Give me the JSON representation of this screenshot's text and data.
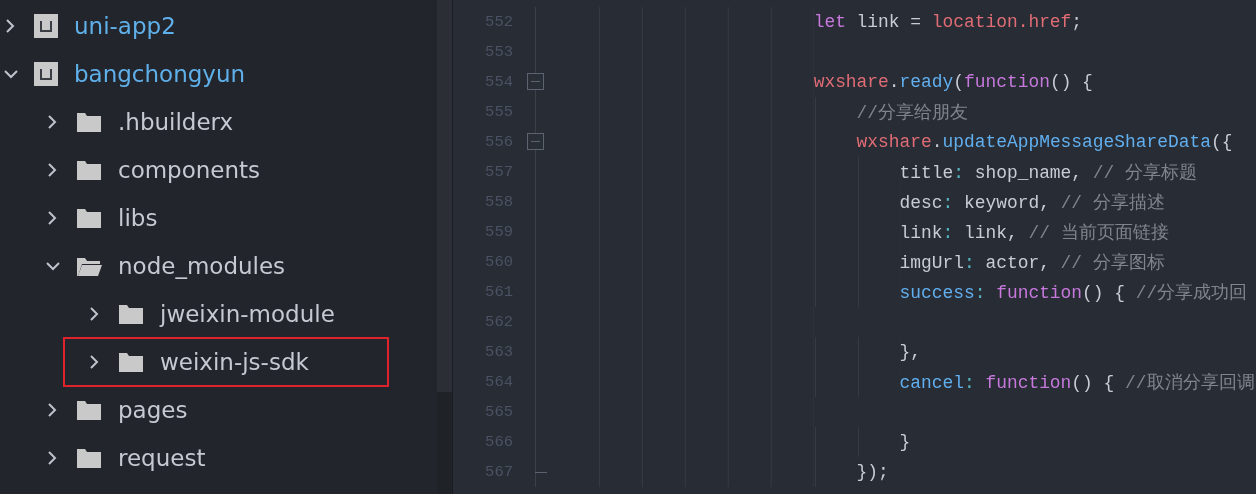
{
  "sidebar": {
    "tree": [
      {
        "kind": "project",
        "name": "uni-app2",
        "expanded": false,
        "highlighted": false
      },
      {
        "kind": "project",
        "name": "bangchongyun",
        "expanded": true,
        "highlighted": false,
        "children": [
          {
            "kind": "folder",
            "name": ".hbuilderx",
            "expanded": false,
            "highlighted": false
          },
          {
            "kind": "folder",
            "name": "components",
            "expanded": false,
            "highlighted": false
          },
          {
            "kind": "folder",
            "name": "libs",
            "expanded": false,
            "highlighted": false
          },
          {
            "kind": "folder",
            "name": "node_modules",
            "expanded": true,
            "highlighted": false,
            "children": [
              {
                "kind": "folder",
                "name": "jweixin-module",
                "expanded": false,
                "highlighted": false
              },
              {
                "kind": "folder",
                "name": "weixin-js-sdk",
                "expanded": false,
                "highlighted": true
              }
            ]
          },
          {
            "kind": "folder",
            "name": "pages",
            "expanded": false,
            "highlighted": false
          },
          {
            "kind": "folder",
            "name": "request",
            "expanded": false,
            "highlighted": false
          }
        ]
      }
    ]
  },
  "editor": {
    "lines": [
      {
        "number": "552",
        "tokens": [
          {
            "kind": "keyword",
            "text": "let"
          },
          {
            "kind": "plain",
            "text": " link = "
          },
          {
            "kind": "object",
            "text": "location.href"
          },
          {
            "kind": "plain",
            "text": ";"
          }
        ]
      },
      {
        "number": "553"
      },
      {
        "number": "554",
        "fold_start": true,
        "tokens": [
          {
            "kind": "object",
            "text": "wxshare"
          },
          {
            "kind": "plain",
            "text": "."
          },
          {
            "kind": "method",
            "text": "ready"
          },
          {
            "kind": "plain",
            "text": "("
          },
          {
            "kind": "keyword",
            "text": "function"
          },
          {
            "kind": "plain",
            "text": "() {"
          }
        ]
      },
      {
        "number": "555",
        "tokens": [
          {
            "kind": "comment",
            "text": "    //分享给朋友"
          }
        ]
      },
      {
        "number": "556",
        "fold_start": true,
        "tokens": [
          {
            "kind": "object",
            "text": "    wxshare"
          },
          {
            "kind": "plain",
            "text": "."
          },
          {
            "kind": "method",
            "text": "updateAppMessageShareData"
          },
          {
            "kind": "plain",
            "text": "({"
          }
        ]
      },
      {
        "number": "557",
        "tokens": [
          {
            "kind": "plain",
            "text": "        title"
          },
          {
            "kind": "colon",
            "text": ":"
          },
          {
            "kind": "plain",
            "text": " shop_name, "
          },
          {
            "kind": "comment",
            "text": "// 分享标题"
          }
        ]
      },
      {
        "number": "558",
        "tokens": [
          {
            "kind": "plain",
            "text": "        desc"
          },
          {
            "kind": "colon",
            "text": ":"
          },
          {
            "kind": "plain",
            "text": " keyword, "
          },
          {
            "kind": "comment",
            "text": "// 分享描述"
          }
        ]
      },
      {
        "number": "559",
        "tokens": [
          {
            "kind": "plain",
            "text": "        link"
          },
          {
            "kind": "colon",
            "text": ":"
          },
          {
            "kind": "plain",
            "text": " link, "
          },
          {
            "kind": "comment",
            "text": "// 当前页面链接"
          }
        ]
      },
      {
        "number": "560",
        "tokens": [
          {
            "kind": "plain",
            "text": "        imgUrl"
          },
          {
            "kind": "colon",
            "text": ":"
          },
          {
            "kind": "plain",
            "text": " actor, "
          },
          {
            "kind": "comment",
            "text": "// 分享图标"
          }
        ]
      },
      {
        "number": "561",
        "tokens": [
          {
            "kind": "method",
            "text": "        success"
          },
          {
            "kind": "colon",
            "text": ":"
          },
          {
            "kind": "keyword",
            "text": " function"
          },
          {
            "kind": "plain",
            "text": "() { "
          },
          {
            "kind": "comment",
            "text": "//分享成功回"
          }
        ]
      },
      {
        "number": "562"
      },
      {
        "number": "563",
        "tokens": [
          {
            "kind": "plain",
            "text": "        },"
          }
        ]
      },
      {
        "number": "564",
        "tokens": [
          {
            "kind": "method",
            "text": "        cancel"
          },
          {
            "kind": "colon",
            "text": ":"
          },
          {
            "kind": "keyword",
            "text": " function"
          },
          {
            "kind": "plain",
            "text": "() { "
          },
          {
            "kind": "comment",
            "text": "//取消分享回调"
          }
        ]
      },
      {
        "number": "565"
      },
      {
        "number": "566",
        "tokens": [
          {
            "kind": "plain",
            "text": "        }"
          }
        ]
      },
      {
        "number": "567",
        "fold_end": true,
        "tokens": [
          {
            "kind": "plain",
            "text": "    });"
          }
        ]
      }
    ]
  }
}
